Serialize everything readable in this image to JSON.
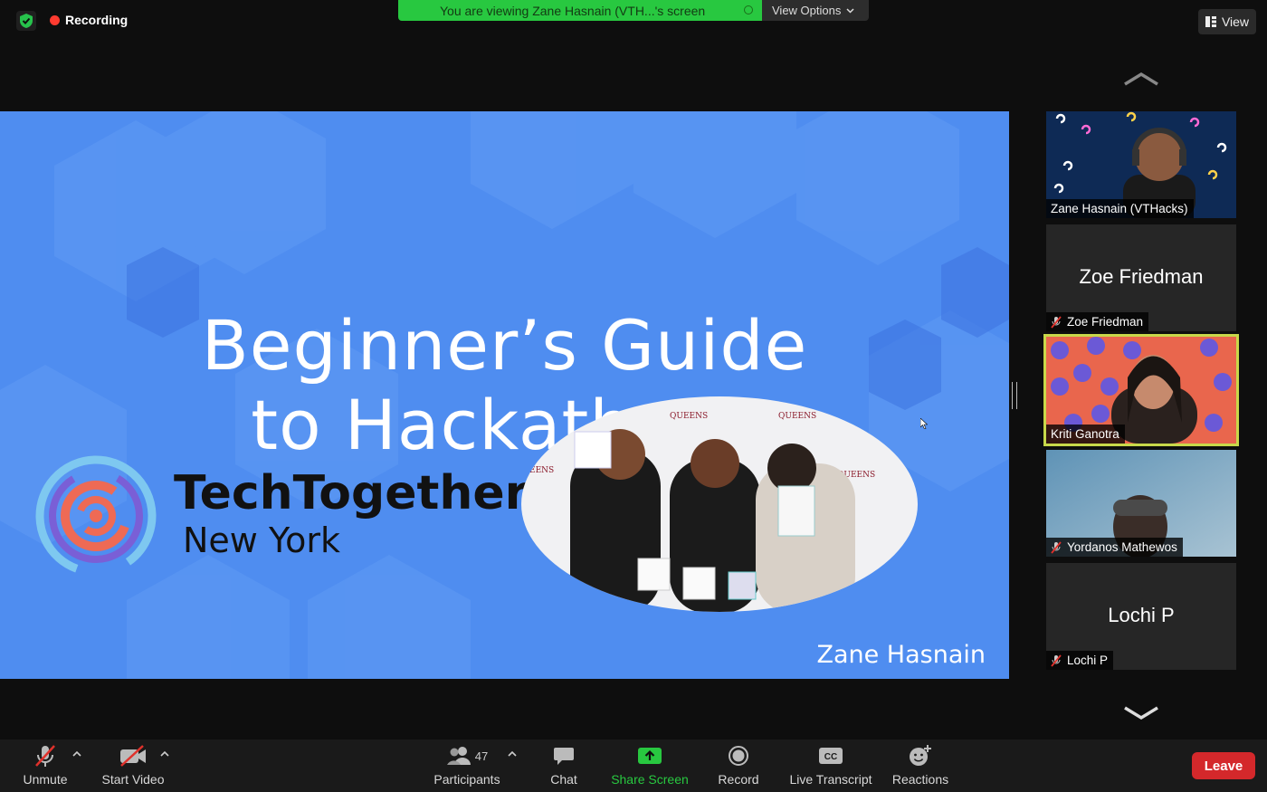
{
  "top_bar": {
    "recording_label": "Recording",
    "viewing_banner": "You are viewing Zane Hasnain (VTH...'s screen",
    "view_options_label": "View Options",
    "view_button_label": "View"
  },
  "shared_slide": {
    "title_line1": "Beginner’s Guide",
    "title_line2": "to Hackathons",
    "brand_name": "TechTogether",
    "brand_city": "New York",
    "presenter": "Zane Hasnain",
    "background_color": "#4f8df0"
  },
  "gallery": {
    "participants": [
      {
        "name": "Zane Hasnain (VTHacks)",
        "video": true,
        "muted": false
      },
      {
        "name": "Zoe Friedman",
        "video": false,
        "muted": true
      },
      {
        "name": "Kriti Ganotra",
        "video": true,
        "muted": false,
        "active_speaker": true
      },
      {
        "name": "Yordanos Mathewos",
        "video": true,
        "muted": true
      },
      {
        "name": "Lochi P",
        "video": false,
        "muted": true
      }
    ]
  },
  "toolbar": {
    "unmute": "Unmute",
    "start_video": "Start Video",
    "participants": "Participants",
    "participants_count": "47",
    "chat": "Chat",
    "share_screen": "Share Screen",
    "record": "Record",
    "live_transcript": "Live Transcript",
    "reactions": "Reactions",
    "leave": "Leave"
  },
  "colors": {
    "share_green": "#28c840",
    "leave_red": "#d4282b",
    "active_speaker_outline": "#c8d84a"
  }
}
